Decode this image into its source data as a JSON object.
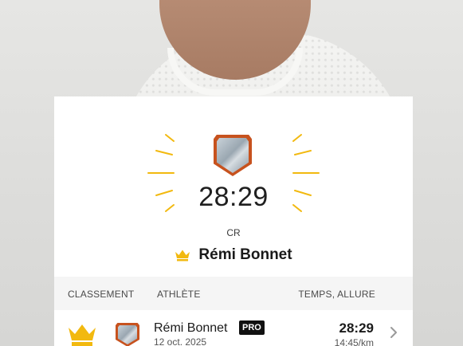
{
  "segment": {
    "best_time": "28:29",
    "record_label": "CR",
    "record_holder": "Rémi Bonnet"
  },
  "leaderboard": {
    "columns": {
      "rank": "CLASSEMENT",
      "athlete": "ATHLÈTE",
      "time_pace": "TEMPS, ALLURE"
    },
    "rows": [
      {
        "rank_icon": "crown-icon",
        "athlete": "Rémi Bonnet",
        "badge": "PRO",
        "date": "12 oct. 2025",
        "time": "28:29",
        "pace": "14:45/km"
      }
    ]
  },
  "icons": {
    "medal": "segment-medal-icon",
    "crown": "crown-icon",
    "chevron": "chevron-right-icon"
  },
  "colors": {
    "accent_gold": "#f2b90f",
    "medal_orange": "#c7521e",
    "pro_badge": "#111111"
  }
}
